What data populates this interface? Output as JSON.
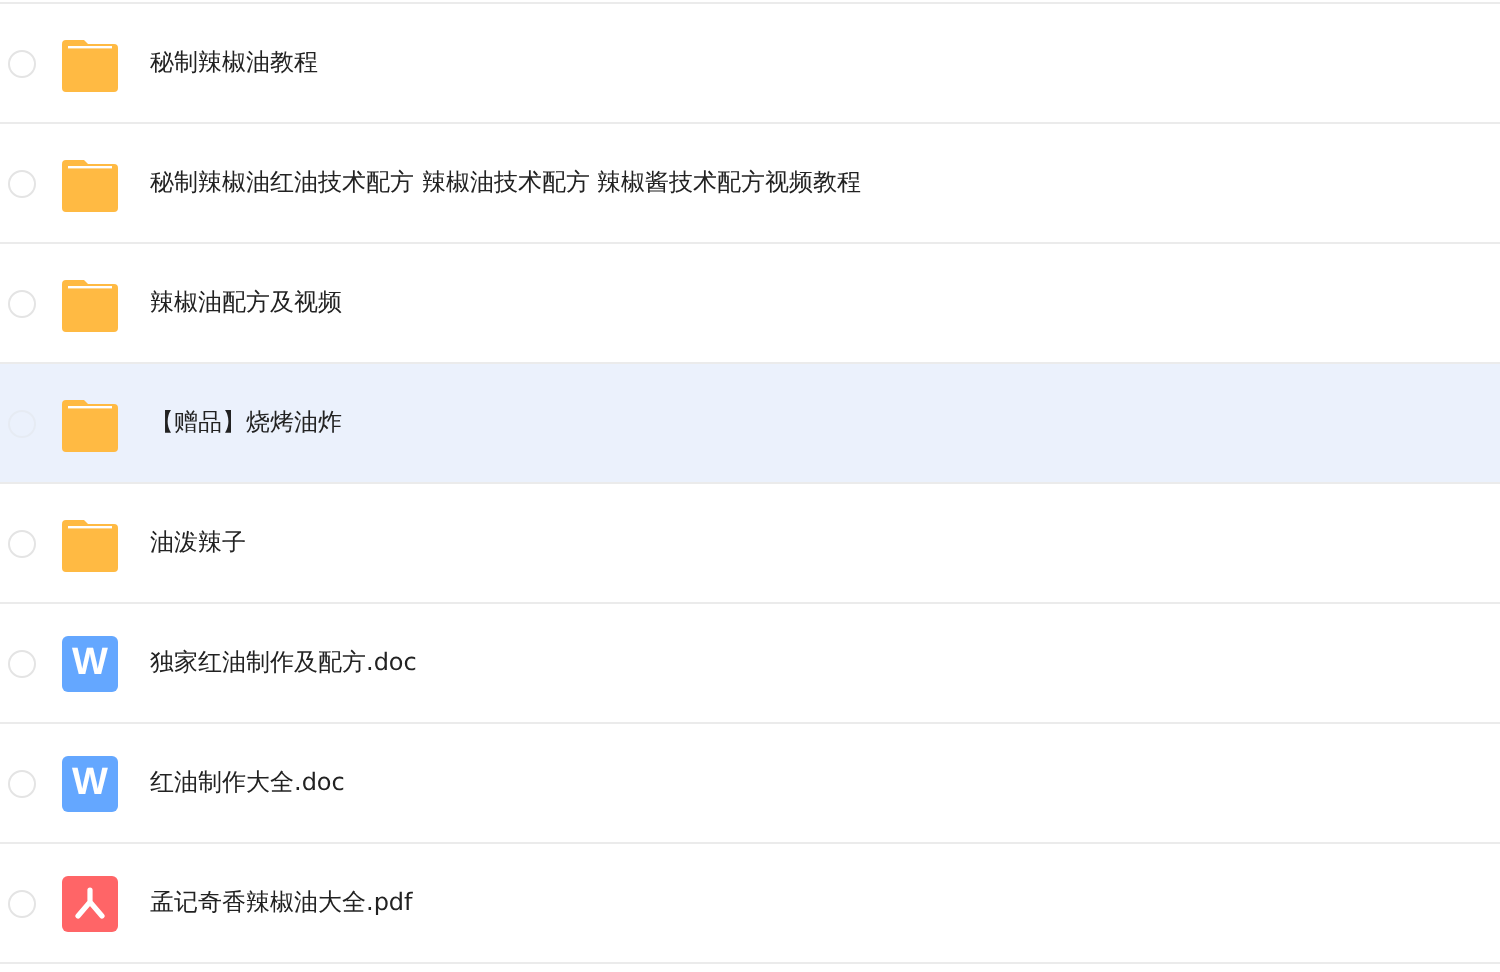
{
  "files": [
    {
      "kind": "folder",
      "name": "秘制辣椒油教程",
      "checked": false,
      "selected": false
    },
    {
      "kind": "folder",
      "name": "秘制辣椒油红油技术配方 辣椒油技术配方 辣椒酱技术配方视频教程",
      "checked": false,
      "selected": false
    },
    {
      "kind": "folder",
      "name": "辣椒油配方及视频",
      "checked": false,
      "selected": false
    },
    {
      "kind": "folder",
      "name": "【赠品】烧烤油炸",
      "checked": false,
      "selected": true
    },
    {
      "kind": "folder",
      "name": "油泼辣子",
      "checked": false,
      "selected": false
    },
    {
      "kind": "doc",
      "icon_text": "W",
      "name": "独家红油制作及配方.doc",
      "checked": false,
      "selected": false
    },
    {
      "kind": "doc",
      "icon_text": "W",
      "name": "红油制作大全.doc",
      "checked": false,
      "selected": false
    },
    {
      "kind": "pdf",
      "name": "孟记奇香辣椒油大全.pdf",
      "checked": false,
      "selected": false
    }
  ]
}
